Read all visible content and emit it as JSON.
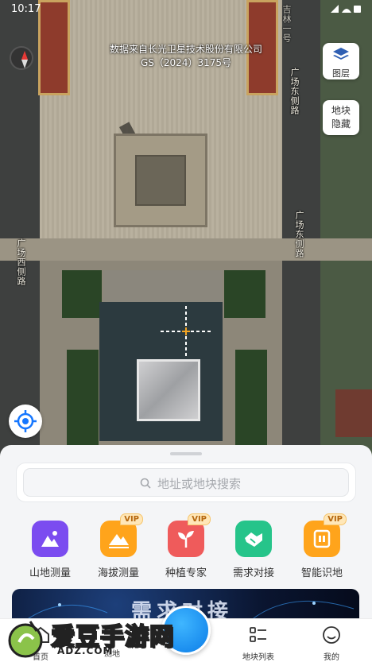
{
  "status_bar": {
    "time": "10:17",
    "right": ""
  },
  "map": {
    "copyright_line1": "数据来自长光卫星技术股份有限公司",
    "copyright_line2": "GS（2024）3175号",
    "road_labels": [
      "广场东侧路",
      "广场西侧路",
      "广场东侧路",
      "吉林一号"
    ]
  },
  "controls": {
    "layer_label": "图层",
    "hide_parcel_line1": "地块",
    "hide_parcel_line2": "隐藏"
  },
  "search": {
    "placeholder": "地址或地块搜索"
  },
  "features": [
    {
      "label": "山地测量",
      "vip": "",
      "color": "#7b4cf0"
    },
    {
      "label": "海拔测量",
      "vip": "VIP",
      "color": "#ffa41b"
    },
    {
      "label": "种植专家",
      "vip": "VIP",
      "color": "#ef5b5b"
    },
    {
      "label": "需求对接",
      "vip": "",
      "color": "#26c48a"
    },
    {
      "label": "智能识地",
      "vip": "VIP",
      "color": "#ffa41b"
    }
  ],
  "banner": {
    "text": "需求对接"
  },
  "tabs": [
    {
      "label": "首页"
    },
    {
      "label": "测地"
    },
    {
      "label": "地块列表"
    },
    {
      "label": "我的"
    }
  ],
  "site_watermark": {
    "title": "爱豆手游网",
    "domain": "ADZ.COM"
  }
}
